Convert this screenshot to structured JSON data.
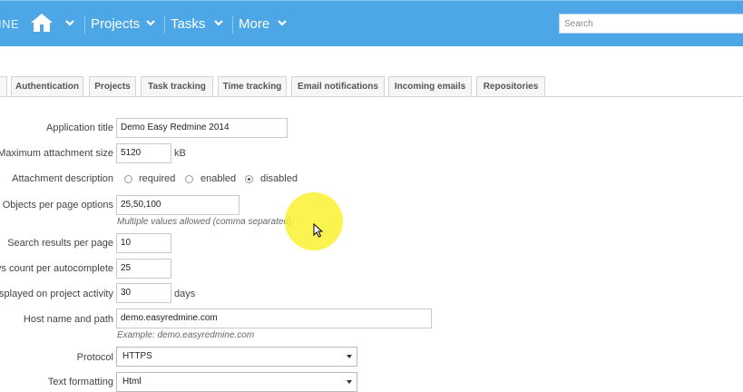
{
  "header": {
    "brand_fragment": "INE",
    "nav": [
      {
        "label": "Projects"
      },
      {
        "label": "Tasks"
      },
      {
        "label": "More"
      }
    ],
    "search_placeholder": "Search",
    "bar_color": "#4da6e6"
  },
  "tabs": [
    {
      "label": "Authentication"
    },
    {
      "label": "Projects"
    },
    {
      "label": "Task tracking"
    },
    {
      "label": "Time tracking"
    },
    {
      "label": "Email notifications"
    },
    {
      "label": "Incoming emails"
    },
    {
      "label": "Repositories"
    }
  ],
  "form": {
    "app_title": {
      "label": "Application title",
      "value": "Demo Easy Redmine 2014"
    },
    "max_attachment": {
      "label": "Maximum attachment size",
      "value": "5120",
      "unit": "kB"
    },
    "attachment_desc": {
      "label": "Attachment description",
      "options": [
        "required",
        "enabled",
        "disabled"
      ],
      "selected": "disabled"
    },
    "objects_per_page": {
      "label": "Objects per page options",
      "value": "25,50,100",
      "hint": "Multiple values allowed (comma separated)."
    },
    "search_results": {
      "label": "Search results per page",
      "value": "10"
    },
    "rows_autocomplete": {
      "label": "vs count per autocomplete",
      "value": "25"
    },
    "days_activity": {
      "label": "isplayed on project activity",
      "value": "30",
      "unit": "days"
    },
    "host_name": {
      "label": "Host name and path",
      "value": "demo.easyredmine.com",
      "hint": "Example: demo.easyredmine.com"
    },
    "protocol": {
      "label": "Protocol",
      "value": "HTTPS"
    },
    "text_formatting": {
      "label": "Text formatting",
      "value": "Html"
    }
  },
  "overlay": {
    "highlight_color": "#faf028"
  }
}
